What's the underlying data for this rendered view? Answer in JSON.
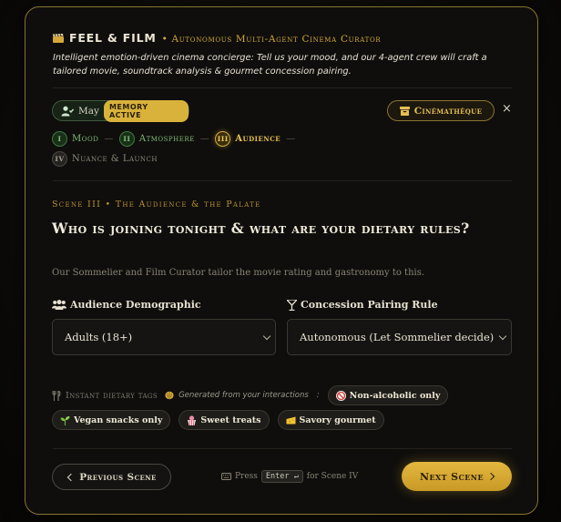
{
  "header": {
    "title": "FEEL & FILM",
    "subtitle": "• Autonomous Multi-Agent Cinema Curator",
    "description": "Intelligent emotion-driven cinema concierge: Tell us your mood, and our 4-agent crew will craft a tailored movie, soundtrack analysis & gourmet concession pairing."
  },
  "memory": {
    "name": "May",
    "badge": "MEMORY ACTIVE"
  },
  "cinematheque": {
    "label": "Cinémathèque"
  },
  "close": {
    "label": "×"
  },
  "steps": [
    {
      "numeral": "I",
      "label": "Mood",
      "state": "done"
    },
    {
      "numeral": "II",
      "label": "Atmosphere",
      "state": "done"
    },
    {
      "numeral": "III",
      "label": "Audience",
      "state": "active"
    },
    {
      "numeral": "IV",
      "label": "Nuance & Launch",
      "state": "todo"
    }
  ],
  "step_separator": "—",
  "scene": {
    "label": "Scene III • The Audience & the Palate",
    "question": "Who is joining tonight & what are your dietary rules?",
    "note": "Our Sommelier and Film Curator tailor the movie rating and gastronomy to this."
  },
  "audience": {
    "label": "Audience Demographic",
    "value": "Adults (18+)"
  },
  "pairing": {
    "label": "Concession Pairing Rule",
    "value": "Autonomous (Let Sommelier decide)"
  },
  "dietary": {
    "title": "Instant dietary tags",
    "generated": "Generated from your interactions",
    "colon": ":",
    "tags": [
      {
        "label": "Non-alcoholic only",
        "icon": "no-alcohol-icon"
      },
      {
        "label": "Vegan snacks only",
        "icon": "seedling-icon"
      },
      {
        "label": "Sweet treats",
        "icon": "candy-icon"
      },
      {
        "label": "Savory gourmet",
        "icon": "cheese-icon"
      }
    ]
  },
  "footer": {
    "prev": "Previous Scene",
    "hint_press": "Press",
    "hint_key": "Enter ↵",
    "hint_for": "for Scene IV",
    "next": "Next Scene"
  },
  "colors": {
    "gold": "#d4a93a",
    "green": "#7fbc77",
    "background": "#0f0e0c"
  }
}
